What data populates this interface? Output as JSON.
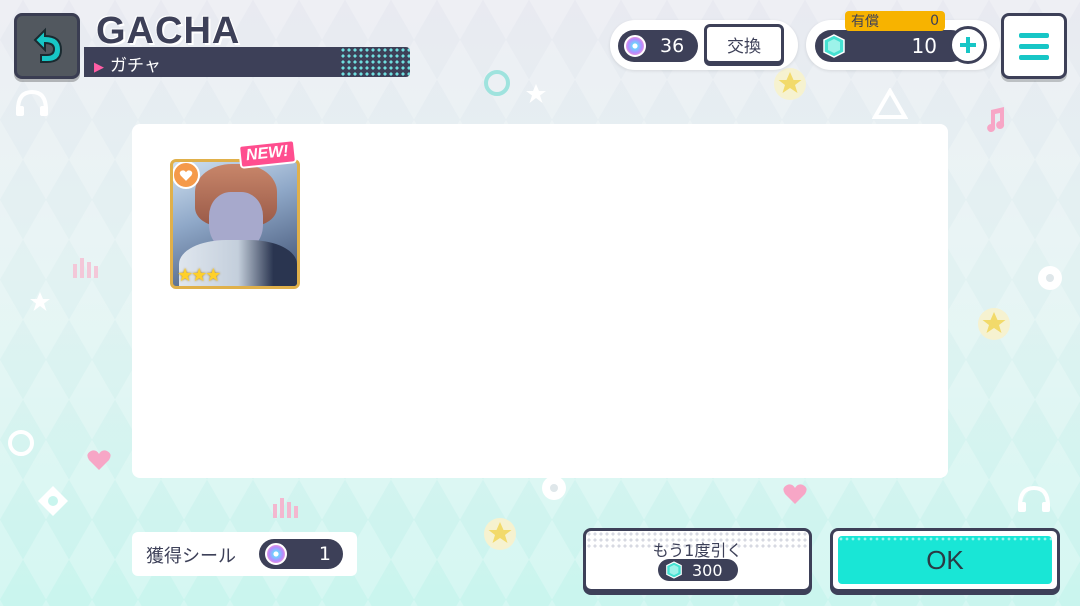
{
  "header": {
    "title_en": "GACHA",
    "title_jp": "ガチャ",
    "back_icon": "undo-arrow-icon"
  },
  "currency": {
    "disc_count": "36",
    "exchange_label": "交換",
    "paid_label": "有償",
    "paid_count": "0",
    "gem_count": "10"
  },
  "result": {
    "new_badge": "NEW!",
    "card_stars": "★★★"
  },
  "bottom": {
    "sticker_label": "獲得シール",
    "sticker_count": "1",
    "draw_again_label": "もう1度引く",
    "draw_again_cost": "300",
    "ok_label": "OK"
  },
  "colors": {
    "navy": "#3d4058",
    "teal": "#19e6d6",
    "pink": "#ff4e8f",
    "gold": "#f7b300"
  }
}
